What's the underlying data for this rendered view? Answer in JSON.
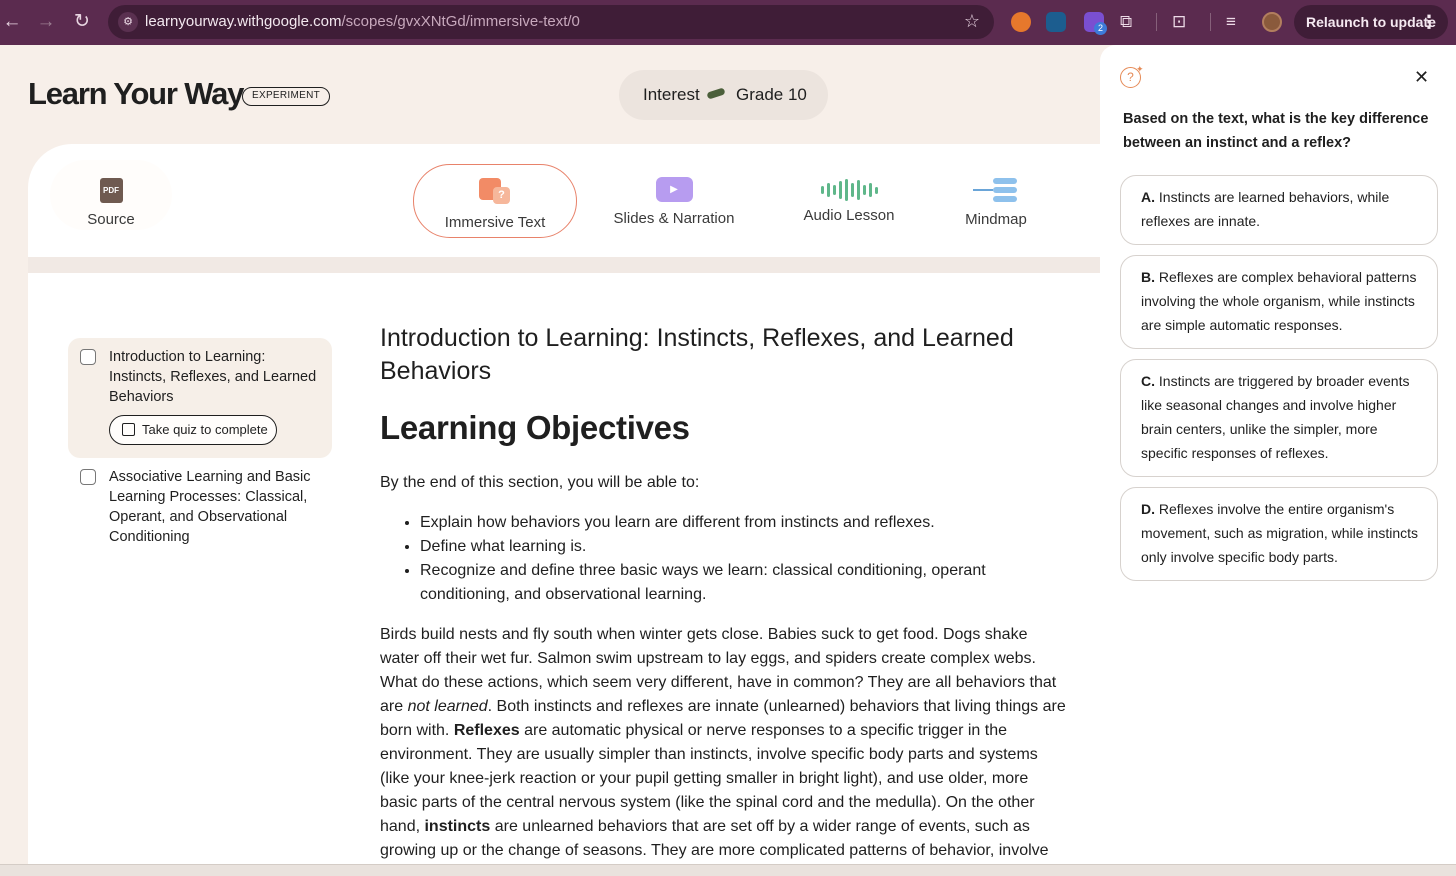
{
  "browser": {
    "url_host": "learnyourway.withgoogle.com",
    "url_path": "/scopes/gvxXNtGd/immersive-text/0",
    "relaunch_label": "Relaunch to update",
    "ext_badge": "2"
  },
  "header": {
    "logo": "Learn Your Way",
    "badge": "EXPERIMENT",
    "interest_label": "Interest",
    "grade_label": "Grade 10"
  },
  "tabs": {
    "source": "Source",
    "immersive": "Immersive Text",
    "slides": "Slides & Narration",
    "audio": "Audio Lesson",
    "mindmap": "Mindmap",
    "pdf_glyph": "PDF"
  },
  "toc": {
    "item1": "Introduction to Learning: Instincts, Reflexes, and Learned Behaviors",
    "quiz_button": "Take quiz to complete",
    "item2": "Associative Learning and Basic Learning Processes: Classical, Operant, and Observational Conditioning"
  },
  "article": {
    "title": "Introduction to Learning: Instincts, Reflexes, and Learned Behaviors",
    "heading": "Learning Objectives",
    "intro": "By the end of this section, you will be able to:",
    "objectives": [
      "Explain how behaviors you learn are different from instincts and reflexes.",
      "Define what learning is.",
      "Recognize and define three basic ways we learn: classical conditioning, operant conditioning, and observational learning."
    ],
    "body_1": "Birds build nests and fly south when winter gets close. Babies suck to get food. Dogs shake water off their wet fur. Salmon swim upstream to lay eggs, and spiders create complex webs. What do these actions, which seem very different, have in common? They are all behaviors that are ",
    "body_em": "not learned",
    "body_2": ". Both instincts and reflexes are innate (unlearned) behaviors that living things are born with. ",
    "body_bold1": "Reflexes",
    "body_3": " are automatic physical or nerve responses to a specific trigger in the environment. They are usually simpler than instincts, involve specific body parts and systems (like your knee-jerk reaction or your pupil getting smaller in bright light), and use older, more basic parts of the central nervous system (like the spinal cord and the medulla). On the other hand, ",
    "body_bold2": "instincts",
    "body_4": " are unlearned behaviors that are set off by a wider range of events, such as growing up or the change of seasons. They are more complicated patterns of behavior, involve"
  },
  "quiz": {
    "question": "Based on the text, what is the key difference between an instinct and a reflex?",
    "options": [
      {
        "letter": "A.",
        "text": "Instincts are learned behaviors, while reflexes are innate."
      },
      {
        "letter": "B.",
        "text": "Reflexes are complex behavioral patterns involving the whole organism, while instincts are simple automatic responses."
      },
      {
        "letter": "C.",
        "text": "Instincts are triggered by broader events like seasonal changes and involve higher brain centers, unlike the simpler, more specific responses of reflexes."
      },
      {
        "letter": "D.",
        "text": "Reflexes involve the entire organism's movement, such as migration, while instincts only involve specific body parts."
      }
    ]
  },
  "colors": {
    "chrome": "#5b2b4f",
    "accent": "#e8826a",
    "page_bg": "#f7efe9"
  }
}
